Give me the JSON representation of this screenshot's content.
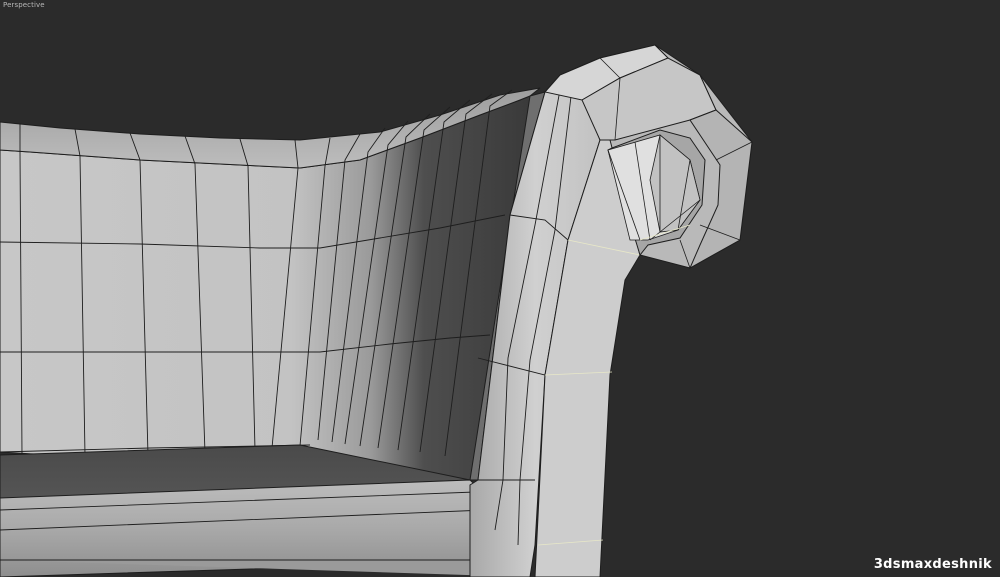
{
  "viewport": {
    "label": "Perspective"
  },
  "watermark": {
    "text": "3dsmaxdeshnik"
  },
  "colors": {
    "background": "#2b2b2b",
    "wire": "#1e1e1e",
    "highlight_edge": "#e8e8c8"
  }
}
